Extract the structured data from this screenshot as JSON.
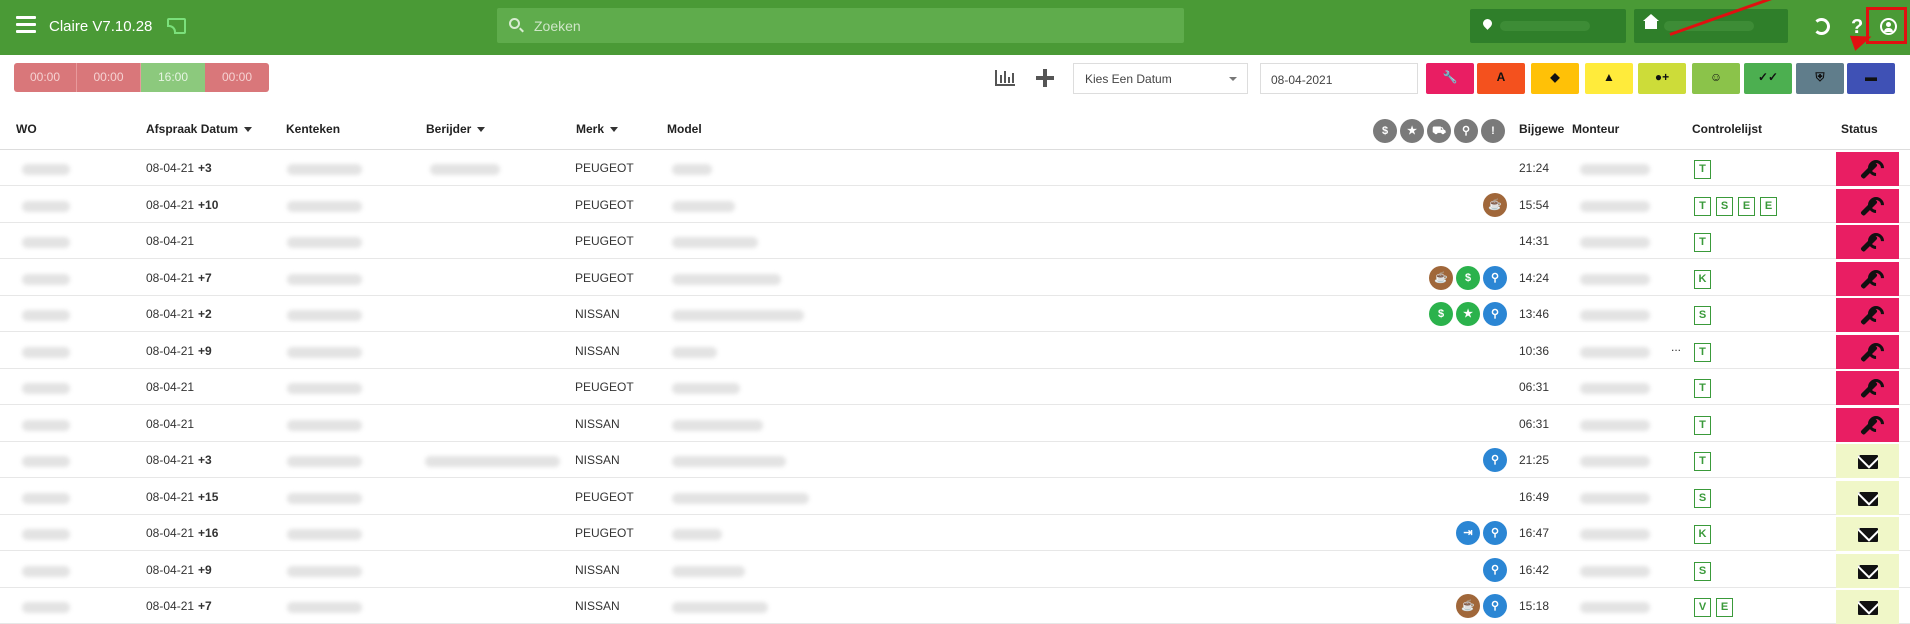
{
  "header": {
    "app_title": "Claire V7.10.28",
    "search_placeholder": "Zoeken"
  },
  "toolbar": {
    "timers": [
      "00:00",
      "00:00",
      "16:00",
      "00:00"
    ],
    "date_select": "Kies Een Datum",
    "date_value": "08-04-2021",
    "filter_buttons": [
      {
        "name": "wrench",
        "color": "#e91e63"
      },
      {
        "name": "letter-a",
        "color": "#f4511e"
      },
      {
        "name": "tag",
        "color": "#ffc107"
      },
      {
        "name": "warning",
        "color": "#ffeb3b"
      },
      {
        "name": "person-plus",
        "color": "#cddc39"
      },
      {
        "name": "smiley",
        "color": "#8bc34a"
      },
      {
        "name": "double-check",
        "color": "#4caf50"
      },
      {
        "name": "shield",
        "color": "#607d8b"
      },
      {
        "name": "car",
        "color": "#3f51b5"
      }
    ]
  },
  "table": {
    "headers": {
      "wo": "WO",
      "afspraak": "Afspraak Datum",
      "kenteken": "Kenteken",
      "berijder": "Berijder",
      "merk": "Merk",
      "model": "Model",
      "bijgewerkt": "Bijgewe",
      "monteur": "Monteur",
      "controlelijst": "Controlelijst",
      "status": "Status"
    },
    "rows": [
      {
        "date": "08-04-21",
        "extra": "+3",
        "merk": "PEUGEOT",
        "time": "21:24",
        "cl": [
          "T"
        ],
        "status": "wrench",
        "badges": []
      },
      {
        "date": "08-04-21",
        "extra": "+10",
        "merk": "PEUGEOT",
        "time": "15:54",
        "cl": [
          "T",
          "S",
          "E",
          "E"
        ],
        "status": "wrench",
        "badges": [
          "coffee"
        ]
      },
      {
        "date": "08-04-21",
        "extra": "",
        "merk": "PEUGEOT",
        "time": "14:31",
        "cl": [
          "T"
        ],
        "status": "wrench",
        "badges": []
      },
      {
        "date": "08-04-21",
        "extra": "+7",
        "merk": "PEUGEOT",
        "time": "14:24",
        "cl": [
          "K"
        ],
        "status": "wrench",
        "badges": [
          "coffee",
          "dollar",
          "pin"
        ]
      },
      {
        "date": "08-04-21",
        "extra": "+2",
        "merk": "NISSAN",
        "time": "13:46",
        "cl": [
          "S"
        ],
        "status": "wrench",
        "badges": [
          "dollar",
          "star",
          "pin"
        ]
      },
      {
        "date": "08-04-21",
        "extra": "+9",
        "merk": "NISSAN",
        "time": "10:36",
        "cl": [
          "T"
        ],
        "status": "wrench",
        "badges": [],
        "monteur_more": "..."
      },
      {
        "date": "08-04-21",
        "extra": "",
        "merk": "PEUGEOT",
        "time": "06:31",
        "cl": [
          "T"
        ],
        "status": "wrench",
        "badges": []
      },
      {
        "date": "08-04-21",
        "extra": "",
        "merk": "NISSAN",
        "time": "06:31",
        "cl": [
          "T"
        ],
        "status": "wrench",
        "badges": []
      },
      {
        "date": "08-04-21",
        "extra": "+3",
        "merk": "NISSAN",
        "time": "21:25",
        "cl": [
          "T"
        ],
        "status": "mail",
        "badges": [
          "pin"
        ]
      },
      {
        "date": "08-04-21",
        "extra": "+15",
        "merk": "PEUGEOT",
        "time": "16:49",
        "cl": [
          "S"
        ],
        "status": "mail",
        "badges": []
      },
      {
        "date": "08-04-21",
        "extra": "+16",
        "merk": "PEUGEOT",
        "time": "16:47",
        "cl": [
          "K"
        ],
        "status": "mail",
        "badges": [
          "transfer",
          "pin"
        ]
      },
      {
        "date": "08-04-21",
        "extra": "+9",
        "merk": "NISSAN",
        "time": "16:42",
        "cl": [
          "S"
        ],
        "status": "mail",
        "badges": [
          "pin"
        ]
      },
      {
        "date": "08-04-21",
        "extra": "+7",
        "merk": "NISSAN",
        "time": "15:18",
        "cl": [
          "V",
          "E"
        ],
        "status": "mail",
        "badges": [
          "coffee",
          "pin"
        ]
      }
    ]
  },
  "badge_colors": {
    "coffee": "#a0673a",
    "dollar": "#2bb24c",
    "pin": "#2b86d4",
    "star": "#2bb24c",
    "transfer": "#2b86d4"
  },
  "header_icons": [
    "dollar",
    "star",
    "cart",
    "pin",
    "warning"
  ]
}
